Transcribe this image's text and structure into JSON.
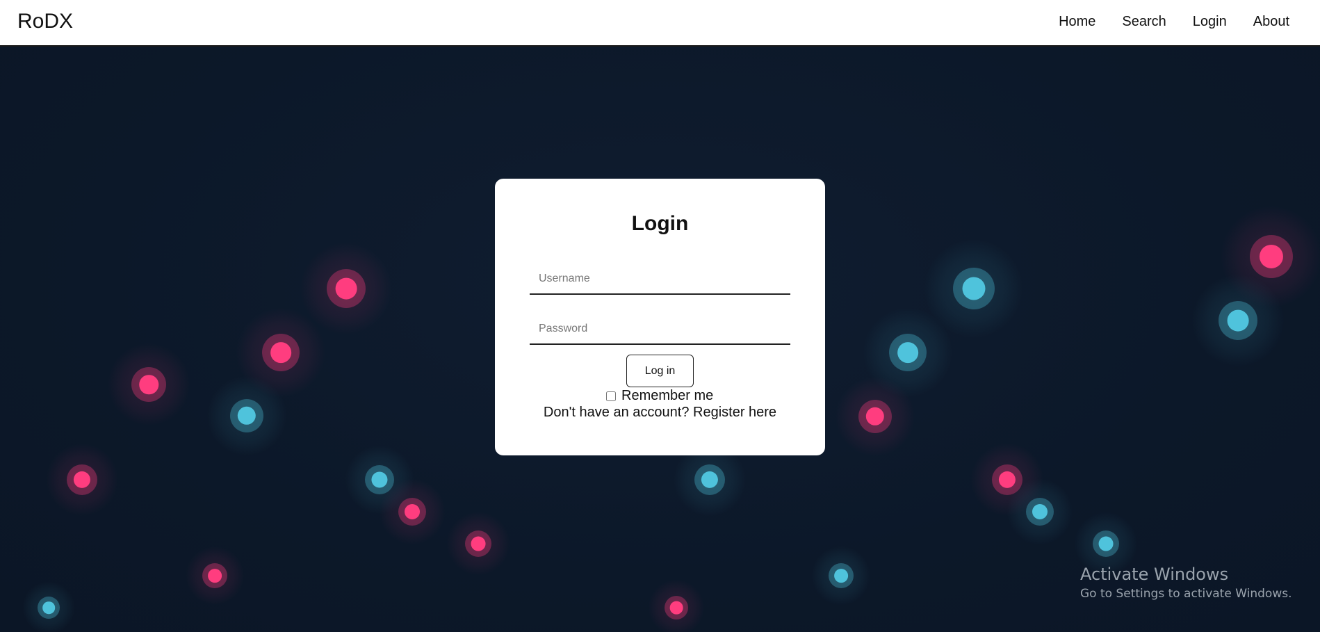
{
  "nav": {
    "brand": "RoDX",
    "links": [
      "Home",
      "Search",
      "Login",
      "About"
    ]
  },
  "login": {
    "title": "Login",
    "username_placeholder": "Username",
    "password_placeholder": "Password",
    "submit_label": "Log in",
    "remember_label": "Remember me",
    "register_text": "Don't have an account? Register here"
  },
  "watermark": {
    "title": "Activate Windows",
    "subtitle": "Go to Settings to activate Windows."
  },
  "colors": {
    "background": "#0e1a2c",
    "pink": "#ff3d7f",
    "cyan": "#4fc3dc"
  }
}
